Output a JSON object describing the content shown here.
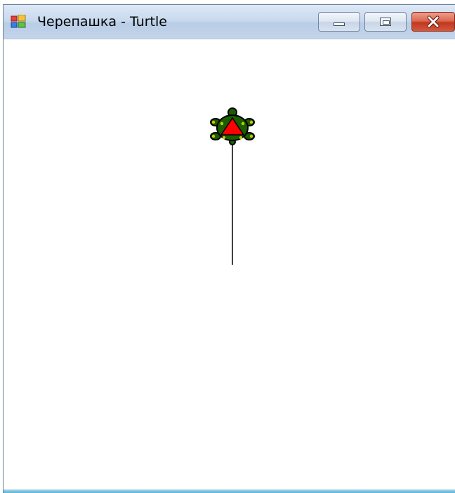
{
  "window": {
    "title": "Черепашка - Turtle",
    "app_icon": "windows-form-icon",
    "controls": {
      "minimize_icon": "minimize-icon",
      "maximize_icon": "maximize-icon",
      "close_icon": "close-icon"
    }
  },
  "canvas": {
    "background": "#ffffff",
    "line_color": "#000000",
    "turtle": {
      "icon": "turtle-icon",
      "body_color": "#1a5e00",
      "spot_color": "#c8c800",
      "triangle_color": "#ff0000",
      "heading": "up"
    }
  },
  "colors": {
    "titlebar": "#c9daee",
    "close_button": "#c3371f",
    "window_border": "#5cb3d6"
  }
}
